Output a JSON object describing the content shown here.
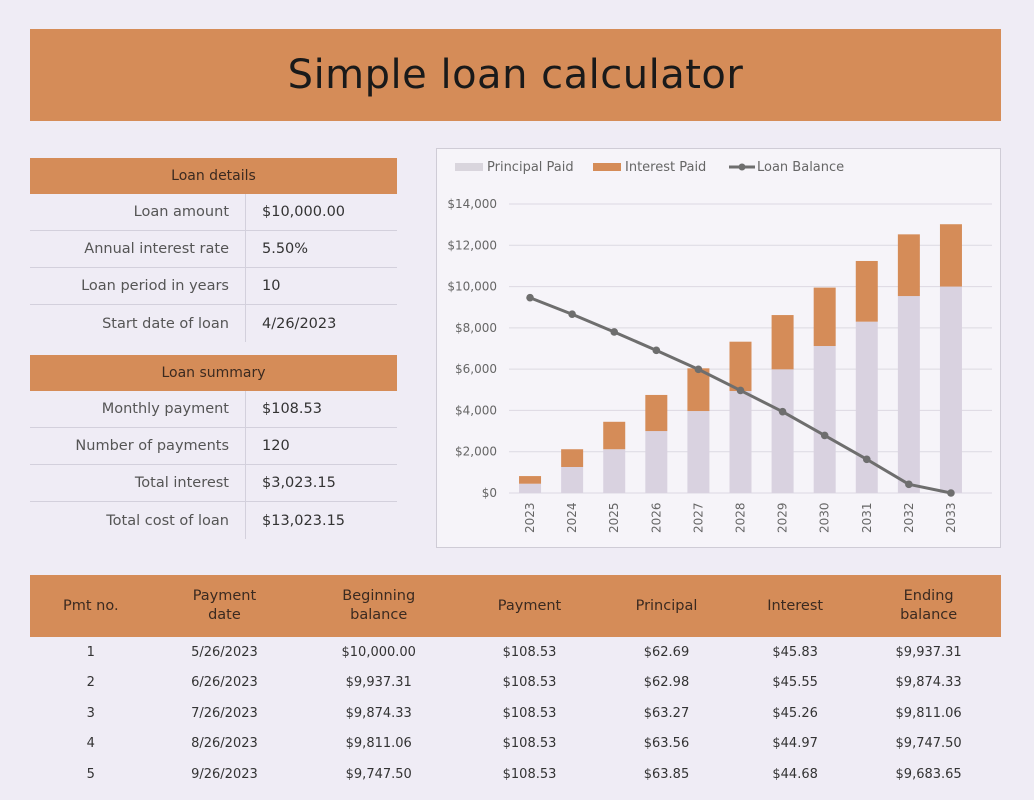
{
  "title": "Simple loan calculator",
  "loan_details": {
    "header": "Loan details",
    "rows": [
      {
        "label": "Loan amount",
        "value": "$10,000.00"
      },
      {
        "label": "Annual interest rate",
        "value": "5.50%"
      },
      {
        "label": "Loan period in years",
        "value": "10"
      },
      {
        "label": "Start date of loan",
        "value": "4/26/2023"
      }
    ]
  },
  "loan_summary": {
    "header": "Loan summary",
    "rows": [
      {
        "label": "Monthly payment",
        "value": "$108.53"
      },
      {
        "label": "Number of payments",
        "value": "120"
      },
      {
        "label": "Total interest",
        "value": "$3,023.15"
      },
      {
        "label": "Total cost of loan",
        "value": "$13,023.15"
      }
    ]
  },
  "colors": {
    "accent": "#d58c58",
    "principal": "#d9d2e0",
    "interest": "#d58c58",
    "balance_line": "#6e6e6e"
  },
  "chart_data": {
    "type": "bar",
    "stacked": true,
    "title": "",
    "xlabel": "",
    "ylabel": "",
    "categories": [
      "2023",
      "2024",
      "2025",
      "2026",
      "2027",
      "2028",
      "2029",
      "2030",
      "2031",
      "2032",
      "2033"
    ],
    "series": [
      {
        "name": "Principal Paid",
        "type": "bar",
        "values": [
          450,
          1260,
          2120,
          3000,
          3970,
          4940,
          5990,
          7120,
          8300,
          9540,
          10000
        ]
      },
      {
        "name": "Interest Paid",
        "type": "bar",
        "values": [
          370,
          860,
          1330,
          1750,
          2070,
          2390,
          2630,
          2830,
          2940,
          2990,
          3020
        ]
      },
      {
        "name": "Loan Balance",
        "type": "line",
        "values": [
          9460,
          8660,
          7800,
          6910,
          5990,
          4970,
          3940,
          2790,
          1630,
          420,
          0
        ]
      }
    ],
    "ylim": [
      0,
      14000
    ],
    "yticks": [
      0,
      2000,
      4000,
      6000,
      8000,
      10000,
      12000,
      14000
    ],
    "ytick_labels": [
      "$0",
      "$2,000",
      "$4,000",
      "$6,000",
      "$8,000",
      "$10,000",
      "$12,000",
      "$14,000"
    ],
    "grid": true,
    "legend": "top-left"
  },
  "schedule": {
    "headers": [
      "Pmt no.",
      "Payment\ndate",
      "Beginning\nbalance",
      "Payment",
      "Principal",
      "Interest",
      "Ending\nbalance"
    ],
    "rows": [
      [
        "1",
        "5/26/2023",
        "$10,000.00",
        "$108.53",
        "$62.69",
        "$45.83",
        "$9,937.31"
      ],
      [
        "2",
        "6/26/2023",
        "$9,937.31",
        "$108.53",
        "$62.98",
        "$45.55",
        "$9,874.33"
      ],
      [
        "3",
        "7/26/2023",
        "$9,874.33",
        "$108.53",
        "$63.27",
        "$45.26",
        "$9,811.06"
      ],
      [
        "4",
        "8/26/2023",
        "$9,811.06",
        "$108.53",
        "$63.56",
        "$44.97",
        "$9,747.50"
      ],
      [
        "5",
        "9/26/2023",
        "$9,747.50",
        "$108.53",
        "$63.85",
        "$44.68",
        "$9,683.65"
      ]
    ]
  }
}
